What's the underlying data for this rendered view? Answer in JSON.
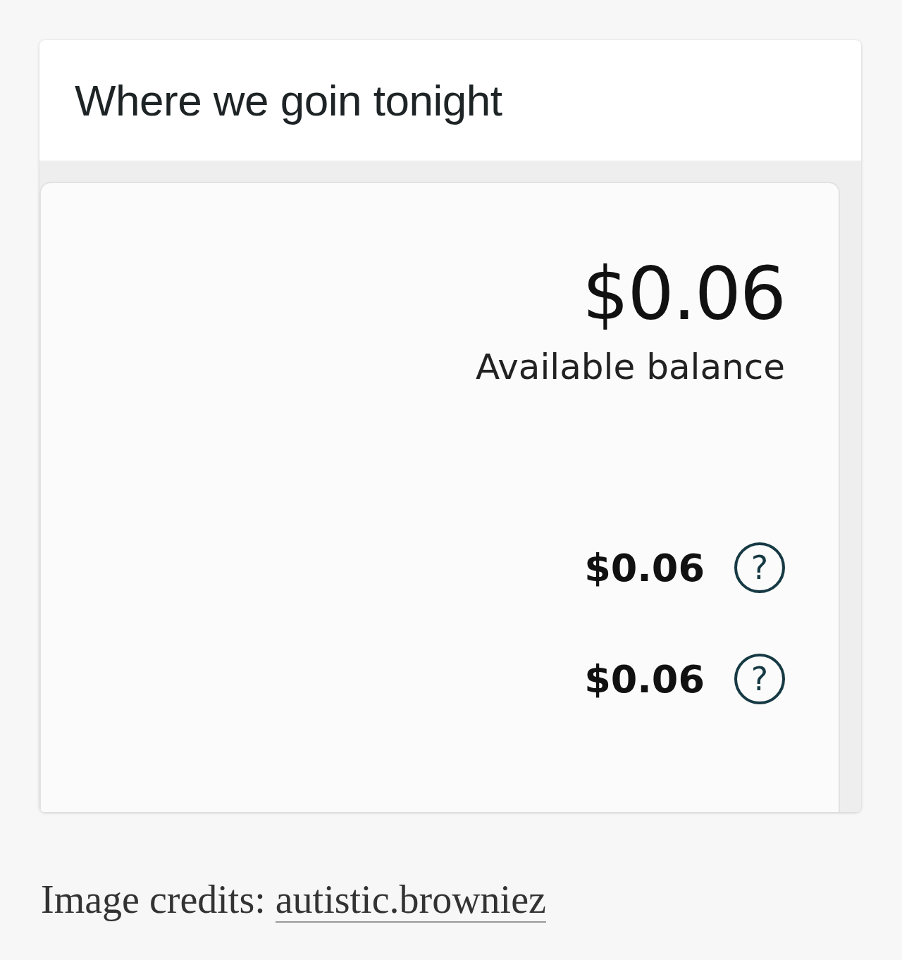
{
  "post": {
    "title": "Where we goin tonight"
  },
  "screenshot": {
    "balance": "$0.06",
    "balance_label": "Available balance",
    "rows": [
      {
        "amount": "$0.06",
        "help": "?"
      },
      {
        "amount": "$0.06",
        "help": "?"
      }
    ]
  },
  "credits": {
    "label": "Image credits:",
    "link": "autistic.browniez"
  }
}
